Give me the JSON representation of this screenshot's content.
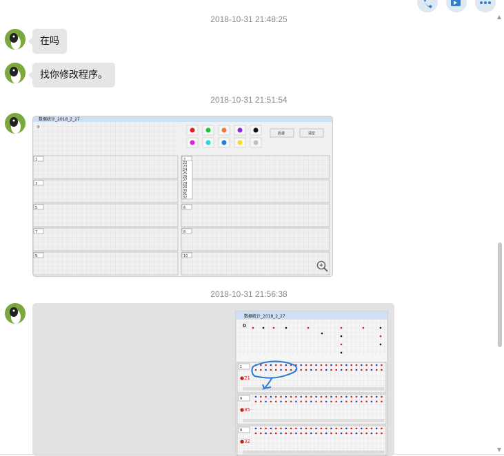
{
  "header": {
    "icons": [
      "phone-icon",
      "video-icon",
      "more-icon"
    ]
  },
  "messages": [
    {
      "timestamp": "2018-10-31 21:48:25",
      "text": "在吗"
    },
    {
      "text": "找你修改程序。"
    },
    {
      "timestamp": "2018-10-31 21:51:54",
      "image": {
        "window_title": "数据统计_2018_2_27",
        "top_cell": "0",
        "buttons": [
          "后退",
          "清空"
        ],
        "dot_colors": [
          "#e02020",
          "#20c040",
          "#f07840",
          "#8a2be2",
          "#111111",
          "#e020e0",
          "#20d8e0",
          "#2080e0",
          "#f0e020",
          "#c0c0c0"
        ],
        "selects": [
          "1",
          "2",
          "3",
          "4",
          "5",
          "6",
          "7",
          "8",
          "9",
          "10"
        ],
        "listbox_items": [
          "22",
          "23",
          "24",
          "25",
          "26",
          "27",
          "28",
          "29",
          "30",
          "31",
          "32"
        ]
      }
    },
    {
      "timestamp": "2018-10-31 21:56:38",
      "image": {
        "window_title": "数据统计_2018_2_27",
        "top_cell": "0",
        "row_labels": [
          "●21",
          "●35",
          "●32"
        ],
        "selects": [
          "1",
          "9",
          "8"
        ]
      }
    }
  ]
}
